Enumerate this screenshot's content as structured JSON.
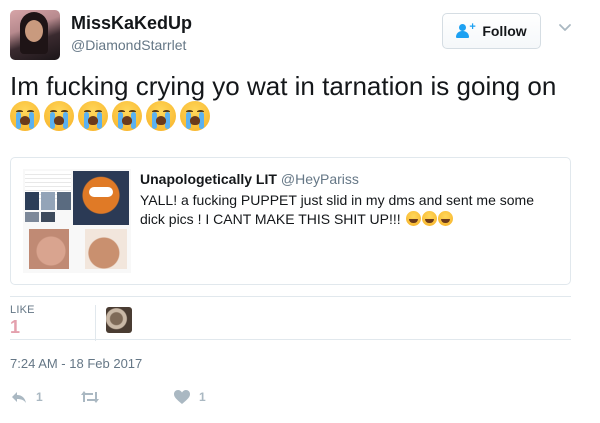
{
  "user": {
    "display_name": "MissKaKedUp",
    "handle": "@DiamondStarrlet",
    "avatar": "profile-photo"
  },
  "follow_button": {
    "label": "Follow",
    "icon": "add-user-icon"
  },
  "menu_icon": "chevron-down-icon",
  "tweet": {
    "text": "Im fucking crying yo wat in tarnation is going on",
    "emoji_count": 6,
    "emoji": "loudly-crying-face"
  },
  "quoted_tweet": {
    "name": "Unapologetically LIT",
    "handle": "@HeyPariss",
    "text": "YALL! a fucking PUPPET just slid in my dms and sent me some dick pics ! I CANT MAKE THIS SHIT UP!!!",
    "emoji": "face-with-tears-of-joy",
    "emoji_count": 3
  },
  "stats": {
    "likes_label": "LIKE",
    "likes_count": "1"
  },
  "timestamp": "7:24 AM - 18 Feb 2017",
  "actions": {
    "reply_count": "1",
    "retweet_count": "",
    "like_count": "1"
  },
  "colors": {
    "text": "#14171a",
    "muted": "#657786",
    "border": "#e1e8ed",
    "accent": "#1da1f2",
    "like_count": "#e4a0ad",
    "action_icon": "#aab8c2"
  }
}
